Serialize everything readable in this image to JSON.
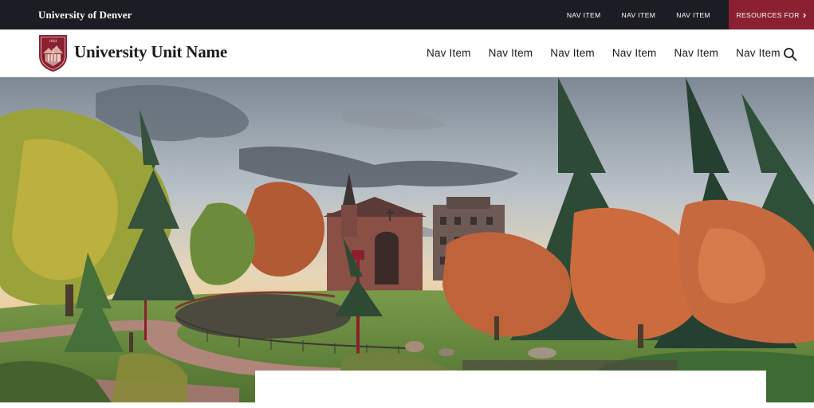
{
  "utility_bar": {
    "brand": "University of Denver",
    "nav_items": [
      "NAV ITEM",
      "NAV ITEM",
      "NAV ITEM"
    ],
    "resources_label": "RESOURCES FOR",
    "resources_icon": "chevron-right-icon"
  },
  "header": {
    "logo_icon": "university-shield-logo",
    "unit_name": "University Unit Name",
    "nav_items": [
      "Nav Item",
      "Nav Item",
      "Nav Item",
      "Nav Item",
      "Nav Item",
      "Nav Item"
    ],
    "search_icon": "search-icon"
  },
  "hero": {
    "image_subject": "campus-autumn-chapel-photo"
  },
  "colors": {
    "utility_bg": "#1c1c24",
    "brand_crimson": "#8b2032",
    "header_bg": "#ffffff"
  }
}
